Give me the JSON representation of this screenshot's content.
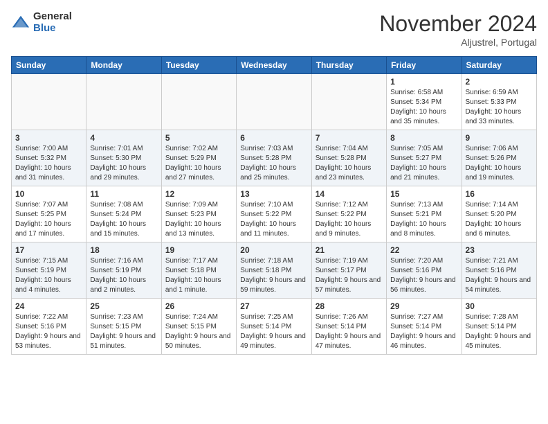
{
  "header": {
    "logo_general": "General",
    "logo_blue": "Blue",
    "month_title": "November 2024",
    "location": "Aljustrel, Portugal"
  },
  "days_of_week": [
    "Sunday",
    "Monday",
    "Tuesday",
    "Wednesday",
    "Thursday",
    "Friday",
    "Saturday"
  ],
  "weeks": [
    {
      "shaded": false,
      "days": [
        {
          "date": "",
          "empty": true
        },
        {
          "date": "",
          "empty": true
        },
        {
          "date": "",
          "empty": true
        },
        {
          "date": "",
          "empty": true
        },
        {
          "date": "",
          "empty": true
        },
        {
          "date": "1",
          "sunrise": "6:58 AM",
          "sunset": "5:34 PM",
          "daylight": "10 hours and 35 minutes."
        },
        {
          "date": "2",
          "sunrise": "6:59 AM",
          "sunset": "5:33 PM",
          "daylight": "10 hours and 33 minutes."
        }
      ]
    },
    {
      "shaded": true,
      "days": [
        {
          "date": "3",
          "sunrise": "7:00 AM",
          "sunset": "5:32 PM",
          "daylight": "10 hours and 31 minutes."
        },
        {
          "date": "4",
          "sunrise": "7:01 AM",
          "sunset": "5:30 PM",
          "daylight": "10 hours and 29 minutes."
        },
        {
          "date": "5",
          "sunrise": "7:02 AM",
          "sunset": "5:29 PM",
          "daylight": "10 hours and 27 minutes."
        },
        {
          "date": "6",
          "sunrise": "7:03 AM",
          "sunset": "5:28 PM",
          "daylight": "10 hours and 25 minutes."
        },
        {
          "date": "7",
          "sunrise": "7:04 AM",
          "sunset": "5:28 PM",
          "daylight": "10 hours and 23 minutes."
        },
        {
          "date": "8",
          "sunrise": "7:05 AM",
          "sunset": "5:27 PM",
          "daylight": "10 hours and 21 minutes."
        },
        {
          "date": "9",
          "sunrise": "7:06 AM",
          "sunset": "5:26 PM",
          "daylight": "10 hours and 19 minutes."
        }
      ]
    },
    {
      "shaded": false,
      "days": [
        {
          "date": "10",
          "sunrise": "7:07 AM",
          "sunset": "5:25 PM",
          "daylight": "10 hours and 17 minutes."
        },
        {
          "date": "11",
          "sunrise": "7:08 AM",
          "sunset": "5:24 PM",
          "daylight": "10 hours and 15 minutes."
        },
        {
          "date": "12",
          "sunrise": "7:09 AM",
          "sunset": "5:23 PM",
          "daylight": "10 hours and 13 minutes."
        },
        {
          "date": "13",
          "sunrise": "7:10 AM",
          "sunset": "5:22 PM",
          "daylight": "10 hours and 11 minutes."
        },
        {
          "date": "14",
          "sunrise": "7:12 AM",
          "sunset": "5:22 PM",
          "daylight": "10 hours and 9 minutes."
        },
        {
          "date": "15",
          "sunrise": "7:13 AM",
          "sunset": "5:21 PM",
          "daylight": "10 hours and 8 minutes."
        },
        {
          "date": "16",
          "sunrise": "7:14 AM",
          "sunset": "5:20 PM",
          "daylight": "10 hours and 6 minutes."
        }
      ]
    },
    {
      "shaded": true,
      "days": [
        {
          "date": "17",
          "sunrise": "7:15 AM",
          "sunset": "5:19 PM",
          "daylight": "10 hours and 4 minutes."
        },
        {
          "date": "18",
          "sunrise": "7:16 AM",
          "sunset": "5:19 PM",
          "daylight": "10 hours and 2 minutes."
        },
        {
          "date": "19",
          "sunrise": "7:17 AM",
          "sunset": "5:18 PM",
          "daylight": "10 hours and 1 minute."
        },
        {
          "date": "20",
          "sunrise": "7:18 AM",
          "sunset": "5:18 PM",
          "daylight": "9 hours and 59 minutes."
        },
        {
          "date": "21",
          "sunrise": "7:19 AM",
          "sunset": "5:17 PM",
          "daylight": "9 hours and 57 minutes."
        },
        {
          "date": "22",
          "sunrise": "7:20 AM",
          "sunset": "5:16 PM",
          "daylight": "9 hours and 56 minutes."
        },
        {
          "date": "23",
          "sunrise": "7:21 AM",
          "sunset": "5:16 PM",
          "daylight": "9 hours and 54 minutes."
        }
      ]
    },
    {
      "shaded": false,
      "days": [
        {
          "date": "24",
          "sunrise": "7:22 AM",
          "sunset": "5:16 PM",
          "daylight": "9 hours and 53 minutes."
        },
        {
          "date": "25",
          "sunrise": "7:23 AM",
          "sunset": "5:15 PM",
          "daylight": "9 hours and 51 minutes."
        },
        {
          "date": "26",
          "sunrise": "7:24 AM",
          "sunset": "5:15 PM",
          "daylight": "9 hours and 50 minutes."
        },
        {
          "date": "27",
          "sunrise": "7:25 AM",
          "sunset": "5:14 PM",
          "daylight": "9 hours and 49 minutes."
        },
        {
          "date": "28",
          "sunrise": "7:26 AM",
          "sunset": "5:14 PM",
          "daylight": "9 hours and 47 minutes."
        },
        {
          "date": "29",
          "sunrise": "7:27 AM",
          "sunset": "5:14 PM",
          "daylight": "9 hours and 46 minutes."
        },
        {
          "date": "30",
          "sunrise": "7:28 AM",
          "sunset": "5:14 PM",
          "daylight": "9 hours and 45 minutes."
        }
      ]
    }
  ]
}
